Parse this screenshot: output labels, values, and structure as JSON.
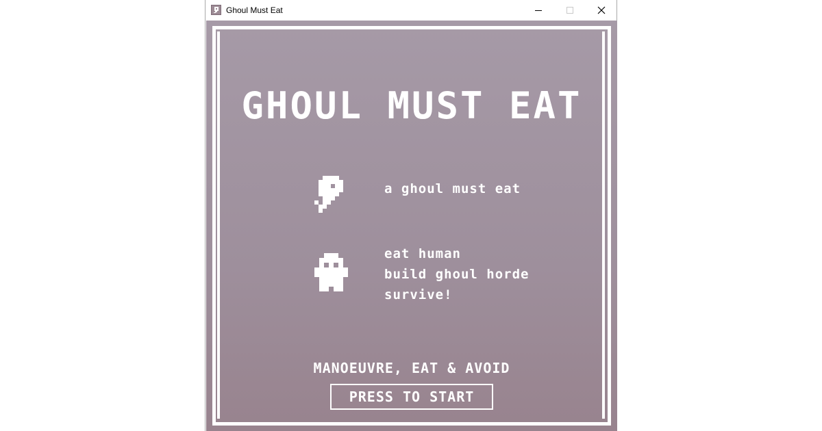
{
  "window": {
    "title": "Ghoul Must Eat",
    "app_icon": "ghoul-app-icon",
    "controls": {
      "minimize": "minimize-icon",
      "maximize": "maximize-icon",
      "close": "close-icon"
    }
  },
  "game": {
    "title": "GHOUL MUST EAT",
    "ghoul_caption": "a ghoul must eat",
    "human_lines": [
      "eat human",
      "build ghoul horde",
      "survive!"
    ],
    "controls_hint": "MANOEUVRE, EAT & AVOID",
    "start_label": "PRESS TO START",
    "colors": {
      "background_top": "#a69aa7",
      "background_bottom": "#98838e",
      "foreground": "#ffffff"
    }
  }
}
